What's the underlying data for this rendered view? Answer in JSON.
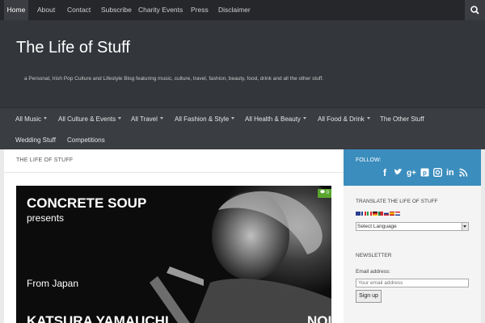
{
  "topnav": {
    "items": [
      "Home",
      "About",
      "Contact",
      "Subscribe",
      "Charity Events",
      "Press",
      "Disclaimer"
    ],
    "active": "Home",
    "search_icon": "search-icon"
  },
  "header": {
    "title": "The Life of Stuff",
    "tagline": "a Personal, Irish Pop Culture and Lifestyle Blog featuring music, culture, travel, fashion, beauty, food, drink and all the other stuff."
  },
  "catnav": {
    "items": [
      {
        "label": "All Music",
        "dropdown": true
      },
      {
        "label": "All Culture & Events",
        "dropdown": true
      },
      {
        "label": "All Travel",
        "dropdown": true
      },
      {
        "label": "All Fashion & Style",
        "dropdown": true
      },
      {
        "label": "All Health & Beauty",
        "dropdown": true
      },
      {
        "label": "All Food & Drink",
        "dropdown": true
      },
      {
        "label": "The Other Stuff",
        "dropdown": false
      },
      {
        "label": "Wedding Stuff",
        "dropdown": false
      },
      {
        "label": "Competitions",
        "dropdown": false
      }
    ]
  },
  "main": {
    "heading": "THE LIFE OF STUFF",
    "feature": {
      "line1": "CONCRETE SOUP",
      "line2": "presents",
      "line3": "From Japan",
      "line4": "KATSURA YAMAUCHI",
      "line5": "NOI",
      "comments": "0"
    }
  },
  "sidebar": {
    "follow_label": "FOLLOW:",
    "social": [
      "facebook-icon",
      "twitter-icon",
      "google-plus-icon",
      "pinterest-icon",
      "instagram-icon",
      "linkedin-icon",
      "rss-icon"
    ],
    "translate_title": "TRANSLATE THE LIFE OF STUFF",
    "language_select": "Select Language",
    "newsletter_title": "NEWSLETTER",
    "email_label": "Email address:",
    "email_placeholder": "Your email address",
    "signup_label": "Sign up"
  },
  "colors": {
    "topnav_bg": "#26272b",
    "header_bg": "#33363b",
    "accent_blue": "#3b8dbd",
    "badge_green": "#5aa52e"
  }
}
